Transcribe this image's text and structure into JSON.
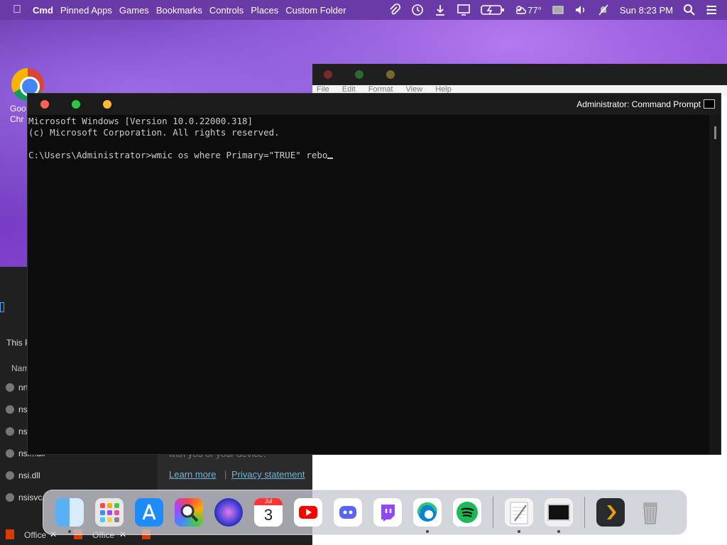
{
  "menubar": {
    "apple": "",
    "items": [
      "Cmd",
      "Pinned Apps",
      "Games",
      "Bookmarks",
      "Controls",
      "Places",
      "Custom Folder"
    ],
    "weather": "77°",
    "datetime": "Sun 8:23 PM"
  },
  "desktop": {
    "chrome_label_line1": "Goo",
    "chrome_label_line2": "Chr"
  },
  "explorer": {
    "this_pc": "This P",
    "name_header": "Nam",
    "files": [
      "nrt",
      "nsl",
      "nsl",
      "nsl...dll",
      "nsi.dll",
      "nsisvc."
    ]
  },
  "privacy_card": {
    "text": "with you or your device.",
    "learn_more": "Learn more",
    "privacy_statement": "Privacy statement"
  },
  "notepad": {
    "menu": [
      "File",
      "Edit",
      "Format",
      "View",
      "Help"
    ]
  },
  "cmd": {
    "title": "Administrator: Command Prompt",
    "line1": "Microsoft Windows [Version 10.0.22000.318]",
    "line2": "(c) Microsoft Corporation. All rights reserved.",
    "prompt": "C:\\Users\\Administrator>wmic os where Primary=\"TRUE\" rebo"
  },
  "dock": {
    "calendar_month": "Jul",
    "calendar_day": "3"
  },
  "taskbar": {
    "item1": "Office",
    "item2": "Office"
  },
  "colors": {
    "menubar": "#6a3aa6",
    "traffic_red": "#ff5f57",
    "traffic_green": "#28c840",
    "traffic_yellow": "#febc2e",
    "console_bg": "#0c0c0c"
  }
}
